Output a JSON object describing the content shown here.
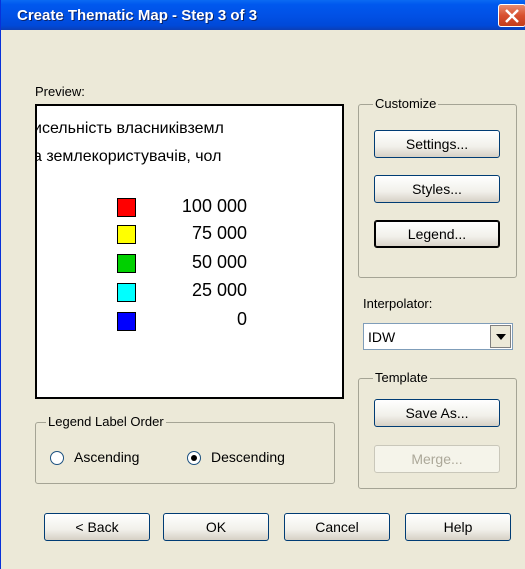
{
  "window": {
    "title": "Create Thematic Map - Step 3 of 3"
  },
  "preview": {
    "label": "Preview:",
    "title_line1": "исельність власниківземл",
    "title_line2": "а землекористувачів, чол",
    "legend": [
      {
        "value": "100 000",
        "color": "#ff0000"
      },
      {
        "value": "75 000",
        "color": "#ffff00"
      },
      {
        "value": "50 000",
        "color": "#00d000"
      },
      {
        "value": "25 000",
        "color": "#00ffff"
      },
      {
        "value": "0",
        "color": "#0000ff"
      }
    ]
  },
  "customize": {
    "label": "Customize",
    "settings_label": "Settings...",
    "styles_label": "Styles...",
    "legend_label": "Legend..."
  },
  "interpolator": {
    "label": "Interpolator:",
    "value": "IDW"
  },
  "template": {
    "label": "Template",
    "save_as_label": "Save As...",
    "merge_label": "Merge..."
  },
  "legend_order": {
    "label": "Legend Label Order",
    "ascending_label": "Ascending",
    "descending_label": "Descending",
    "selected": "Descending"
  },
  "footer": {
    "back_label": "< Back",
    "ok_label": "OK",
    "cancel_label": "Cancel",
    "help_label": "Help"
  }
}
